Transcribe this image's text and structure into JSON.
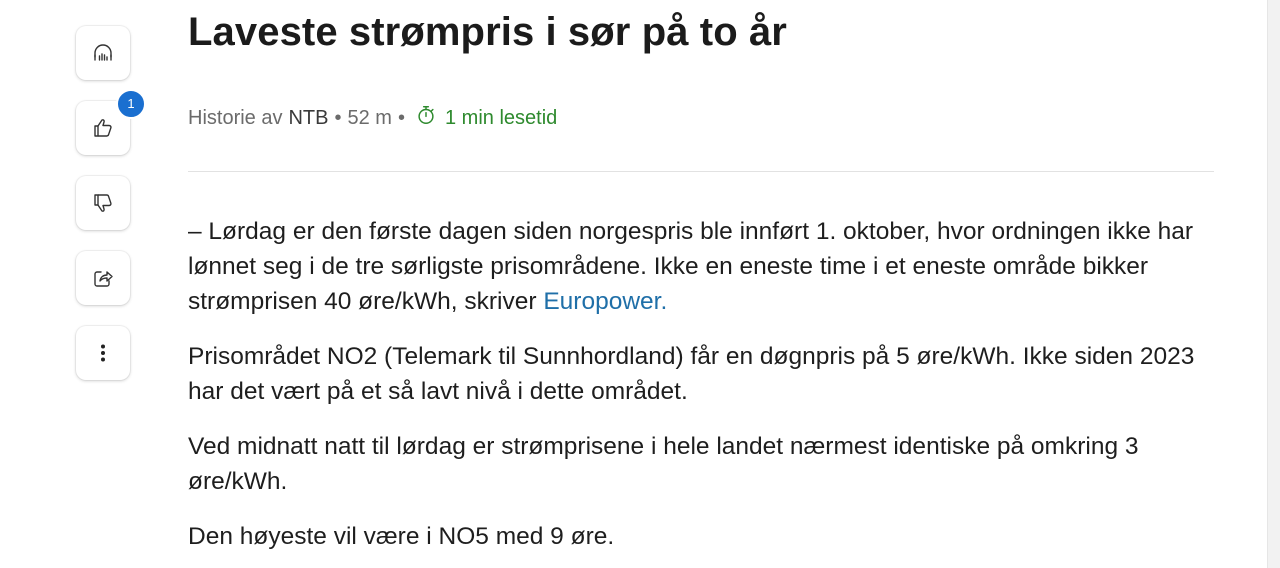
{
  "article": {
    "title": "Laveste strømpris i sør på to år",
    "meta": {
      "prefix": "Historie av",
      "author": "NTB",
      "separator": "•",
      "age": "52 m",
      "read_time": "1 min lesetid"
    },
    "paragraphs": {
      "p1_text": "– Lørdag er den første dagen siden norgespris ble innført 1. oktober, hvor ordningen ikke har lønnet seg i de tre sørligste prisområdene. Ikke en eneste time i et eneste område bikker strømprisen 40 øre/kWh, skriver",
      "p1_link": "Europower.",
      "p2": "Prisområdet NO2 (Telemark til Sunnhordland) får en døgnpris på 5 øre/kWh. Ikke siden 2023 har det vært på et så lavt nivå i dette området.",
      "p3": "Ved midnatt natt til lørdag er strømprisene i hele landet nærmest identiske på omkring 3 øre/kWh.",
      "p4": "Den høyeste vil være i NO5 med 9 øre."
    }
  },
  "rail": {
    "listen_icon": "headphones-icon",
    "like_icon": "thumbs-up-icon",
    "like_badge": "1",
    "dislike_icon": "thumbs-down-icon",
    "share_icon": "share-icon",
    "more_icon": "more-vertical-icon"
  },
  "colors": {
    "accent_link": "#1f6fa8",
    "read_time_green": "#2e8a2e",
    "badge_blue": "#1a6fd0"
  }
}
